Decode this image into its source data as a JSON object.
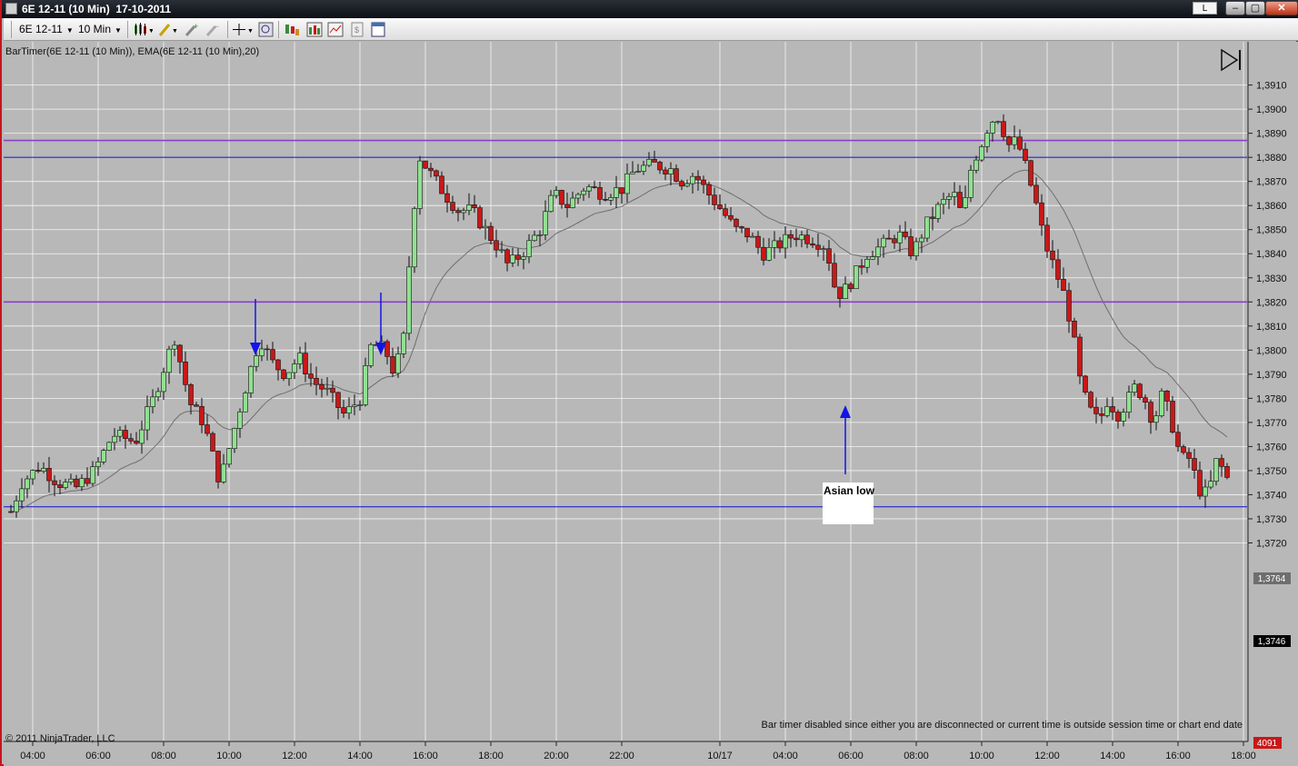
{
  "window": {
    "title": "6E 12-11 (10 Min)  17-10-2011",
    "link_label": "L",
    "min_label": "–",
    "max_label": "▢",
    "close_label": "✕"
  },
  "toolbar": {
    "instrument": "6E 12-11",
    "interval": "10 Min",
    "icons": [
      "candlestick-style-icon",
      "drawing-pencil-icon",
      "add-indicator-icon",
      "remove-indicator-icon",
      "crosshair-icon",
      "zoom-icon",
      "strategies-icon",
      "bar-chart-icon",
      "chart-image-icon",
      "data-box-icon",
      "properties-icon"
    ]
  },
  "chart": {
    "indicator_label": "BarTimer(6E 12-11 (10 Min)), EMA(6E 12-11 (10 Min),20)",
    "copyright": "© 2011 NinjaTrader, LLC",
    "bar_timer_message": "Bar timer disabled since either you are disconnected or current time is outside session time or chart end date",
    "annotation": "Asian low",
    "price_badge_1": "1,3764",
    "price_badge_2": "1,3746",
    "volume_badge": "4091",
    "colors": {
      "background": "#b8b8b8",
      "up_candle": "#90e090",
      "down_candle": "#c81818",
      "ema": "#6e6e6e",
      "purple_line": "#8a40c8",
      "blue_line": "#1010c8",
      "arrow": "#1414e6"
    }
  },
  "chart_data": {
    "type": "candlestick",
    "y_ticks": [
      "1,3910",
      "1,3900",
      "1,3890",
      "1,3880",
      "1,3870",
      "1,3860",
      "1,3850",
      "1,3840",
      "1,3830",
      "1,3820",
      "1,3810",
      "1,3800",
      "1,3790",
      "1,3780",
      "1,3770",
      "1,3760",
      "1,3750",
      "1,3740",
      "1,3730",
      "1,3720"
    ],
    "x_ticks": [
      "04:00",
      "06:00",
      "08:00",
      "10:00",
      "12:00",
      "14:00",
      "16:00",
      "18:00",
      "20:00",
      "22:00",
      "10/17",
      "04:00",
      "06:00",
      "08:00",
      "10:00",
      "12:00",
      "14:00",
      "16:00",
      "18:00"
    ],
    "ylim": [
      1.3717,
      1.3924
    ],
    "horizontal_lines": [
      {
        "price": 1.3887,
        "color": "purple"
      },
      {
        "price": 1.388,
        "color": "blue"
      },
      {
        "price": 1.382,
        "color": "purple"
      },
      {
        "price": 1.3735,
        "color": "blue"
      }
    ],
    "down_arrows": [
      {
        "time": "10:50"
      },
      {
        "time": "14:40"
      }
    ],
    "up_arrows": [
      {
        "time": "05:50",
        "label": "Asian low"
      }
    ],
    "last_price": 1.3746,
    "ema_value": 1.3764
  }
}
